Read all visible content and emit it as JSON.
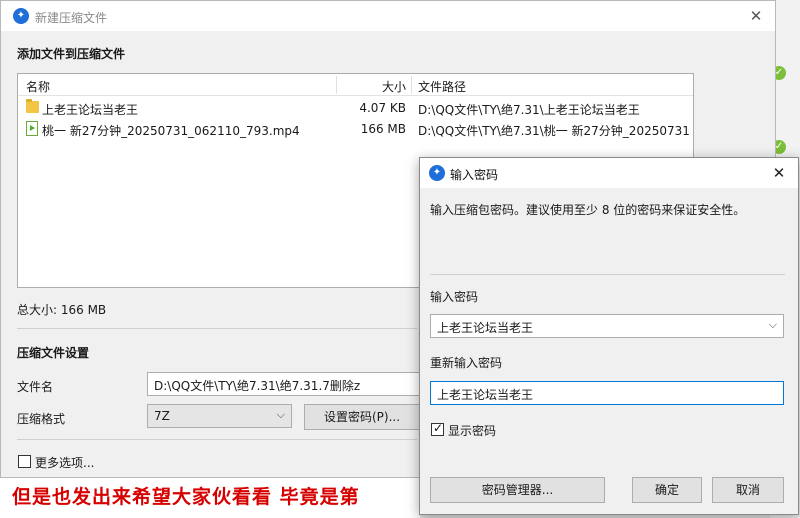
{
  "main_window": {
    "title": "新建压缩文件",
    "add_section_title": "添加文件到压缩文件",
    "columns": {
      "name": "名称",
      "size": "大小",
      "path": "文件路径"
    },
    "files": [
      {
        "icon": "folder-icon",
        "name": "上老王论坛当老王",
        "size": "4.07 KB",
        "path": "D:\\QQ文件\\TY\\绝7.31\\上老王论坛当老王"
      },
      {
        "icon": "video-file-icon",
        "name": "桃一 新27分钟_20250731_062110_793.mp4",
        "size": "166 MB",
        "path": "D:\\QQ文件\\TY\\绝7.31\\桃一 新27分钟_20250731..."
      }
    ],
    "total_size": "总大小: 166 MB",
    "settings_title": "压缩文件设置",
    "filename_label": "文件名",
    "filename_value": "D:\\QQ文件\\TY\\绝7.31\\绝7.31.7删除z",
    "format_label": "压缩格式",
    "format_value": "7Z",
    "set_password_label": "设置密码(P)...",
    "more_options_label": "更多选项..."
  },
  "background": {
    "red_banner_text": "但是也发出来希望大家伙看看 毕竟是第"
  },
  "password_dialog": {
    "title": "输入密码",
    "description": "输入压缩包密码。建议使用至少 8 位的密码来保证安全性。",
    "password_label": "输入密码",
    "password_value": "上老王论坛当老王",
    "reenter_label": "重新输入密码",
    "reenter_value": "上老王论坛当老王",
    "show_password_label": "显示密码",
    "show_password_checked": true,
    "manager_button": "密码管理器...",
    "ok_button": "确定",
    "cancel_button": "取消"
  }
}
